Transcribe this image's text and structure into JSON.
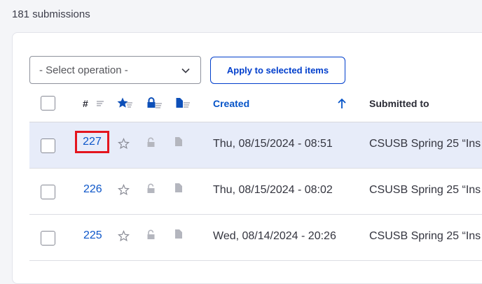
{
  "header": {
    "submission_count": "181 submissions"
  },
  "toolbar": {
    "operation_select": "- Select operation -",
    "apply_label": "Apply to selected items"
  },
  "table": {
    "columns": {
      "number": "#",
      "created": "Created",
      "submitted_to": "Submitted to"
    },
    "rows": [
      {
        "number": "227",
        "created": "Thu, 08/15/2024 - 08:51",
        "submitted_to": "CSUSB Spring 25 “Ins"
      },
      {
        "number": "226",
        "created": "Thu, 08/15/2024 - 08:02",
        "submitted_to": "CSUSB Spring 25 “Ins"
      },
      {
        "number": "225",
        "created": "Wed, 08/14/2024 - 20:26",
        "submitted_to": "CSUSB Spring 25 “Ins"
      }
    ]
  },
  "colors": {
    "accent": "#0654c8",
    "highlight_box": "#e4151e",
    "selected_row": "#e7ecf9"
  }
}
